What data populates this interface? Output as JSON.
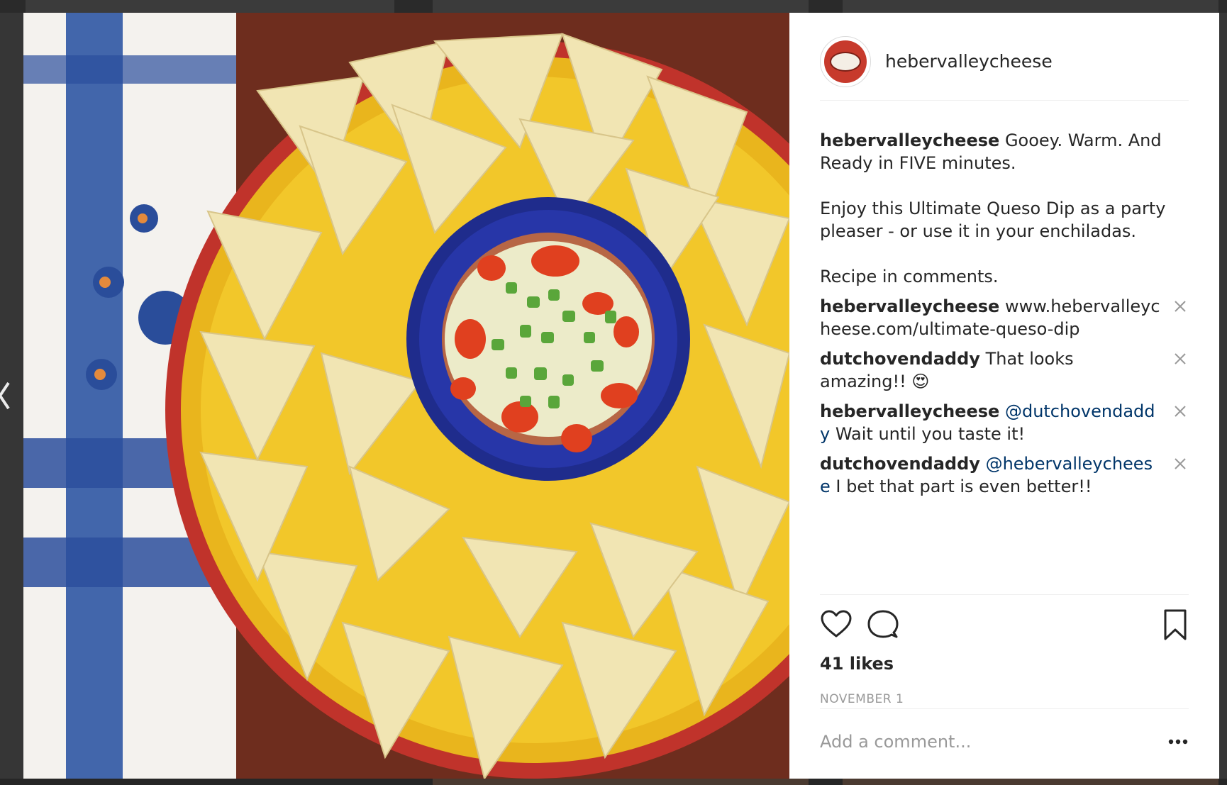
{
  "post": {
    "username": "hebervalleycheese",
    "caption_username": "hebervalleycheese",
    "caption_lines": [
      "Gooey. Warm. And Ready in FIVE minutes.",
      "Enjoy this Ultimate Queso Dip as a party pleaser - or use it in your enchiladas.",
      "Recipe in comments."
    ],
    "comments": [
      {
        "user": "hebervalleycheese",
        "mention": "",
        "text": "www.hebervalleycheese.com/ultimate-queso-dip"
      },
      {
        "user": "dutchovendaddy",
        "mention": "",
        "text": "That looks amazing!! 😍"
      },
      {
        "user": "hebervalleycheese",
        "mention": "@dutchovendaddy",
        "text": "Wait until you taste it!"
      },
      {
        "user": "dutchovendaddy",
        "mention": "@hebervalleycheese",
        "text": "I bet that part is even better!!"
      }
    ],
    "likes": "41 likes",
    "date": "NOVEMBER 1",
    "add_comment_placeholder": "Add a comment...",
    "icons": {
      "like": "heart-icon",
      "comment": "comment-icon",
      "save": "bookmark-icon",
      "more": "more-options-icon",
      "delete": "close-icon",
      "prev": "chevron-left-icon"
    }
  },
  "colors": {
    "mention": "#003569",
    "text": "#262626",
    "muted": "#999999",
    "backdrop": "#363636"
  }
}
